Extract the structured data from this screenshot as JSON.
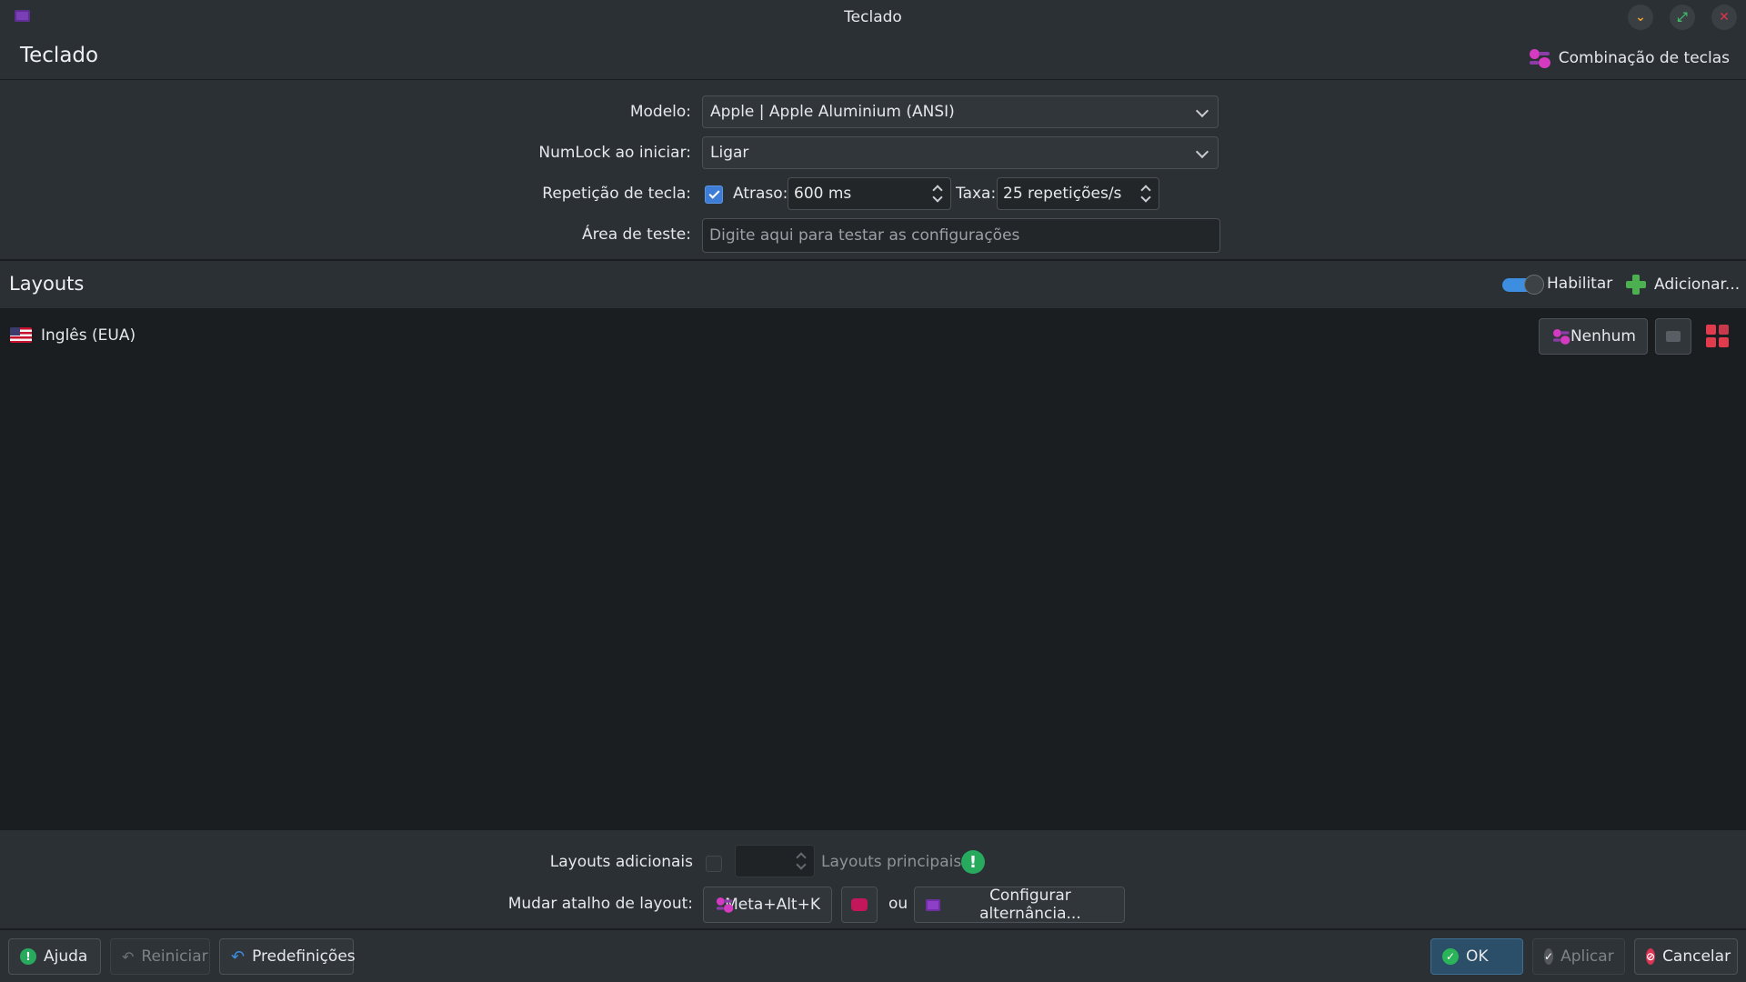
{
  "window": {
    "title": "Teclado"
  },
  "header": {
    "title": "Teclado",
    "shortcuts_label": "Combinação de teclas"
  },
  "form": {
    "model_label": "Modelo:",
    "model_value": "Apple | Apple Aluminium (ANSI)",
    "numlock_label": "NumLock ao iniciar:",
    "numlock_value": "Ligar",
    "repeat_label": "Repetição de tecla:",
    "repeat_checked": true,
    "delay_label": "Atraso:",
    "delay_value": "600 ms",
    "rate_label": "Taxa:",
    "rate_value": "25 repetições/s",
    "test_label": "Área de teste:",
    "test_placeholder": "Digite aqui para testar as configurações"
  },
  "layouts": {
    "title": "Layouts",
    "enable_label": "Habilitar",
    "add_label": "Adicionar...",
    "items": [
      {
        "label": "Inglês (EUA)",
        "shortcut_label": "Nenhum"
      }
    ]
  },
  "options": {
    "extra_layouts_label": "Layouts adicionais",
    "main_layouts_label": "Layouts principais",
    "switch_shortcut_label": "Mudar atalho de layout:",
    "shortcut_value": "Meta+Alt+K",
    "or_label": "ou",
    "configure_label": "Configurar alternância..."
  },
  "footer": {
    "help": "Ajuda",
    "reset": "Reiniciar",
    "defaults": "Predefinições",
    "ok": "OK",
    "apply": "Aplicar",
    "cancel": "Cancelar"
  },
  "colors": {
    "accent": "#3d8ee0",
    "window_bg": "#2b3035",
    "view_bg": "#1b1e21"
  }
}
